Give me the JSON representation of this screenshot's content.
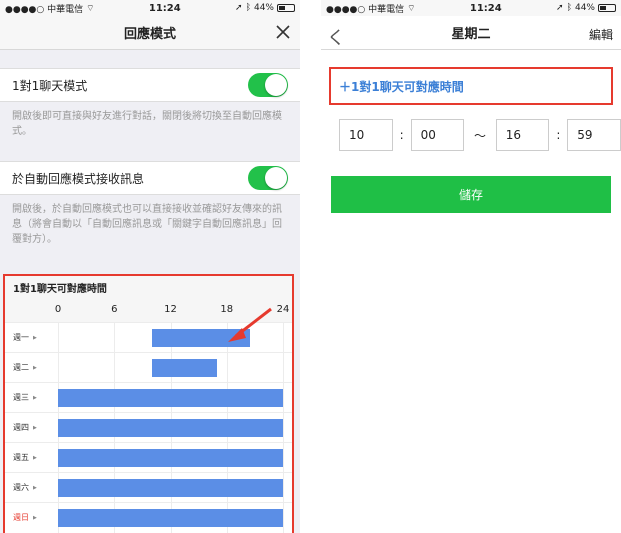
{
  "colors": {
    "toggle_on": "#22c14a",
    "highlight": "#e63a2e",
    "bar": "#5b8ee6",
    "link": "#3b7fd6",
    "save": "#1fbf46"
  },
  "status": {
    "carrier": "●●●●○ 中華電信",
    "time": "11:24",
    "battery": "44%"
  },
  "left": {
    "title": "回應模式",
    "close_icon": "close-icon",
    "chat_mode_label": "1對1聊天模式",
    "chat_mode_desc": "開啟後即可直接與好友進行對話，關閉後將切換至自動回應模式。",
    "auto_receive_label": "於自動回應模式接收訊息",
    "auto_receive_desc": "開啟後，於自動回應模式也可以直接接收並確認好友傳來的訊息（將會自動以「自動回應訊息或「關鍵字自動回應訊息」回覆對方）。",
    "schedule": {
      "title": "1對1聊天可對應時間",
      "hours": [
        "0",
        "6",
        "12",
        "18",
        "24"
      ],
      "days": [
        {
          "label": "週一",
          "start": 10,
          "end": 20.5,
          "sunday": false
        },
        {
          "label": "週二",
          "start": 10,
          "end": 17,
          "sunday": false
        },
        {
          "label": "週三",
          "start": 0,
          "end": 24,
          "sunday": false
        },
        {
          "label": "週四",
          "start": 0,
          "end": 24,
          "sunday": false
        },
        {
          "label": "週五",
          "start": 0,
          "end": 24,
          "sunday": false
        },
        {
          "label": "週六",
          "start": 0,
          "end": 24,
          "sunday": false
        },
        {
          "label": "週日",
          "start": 0,
          "end": 24,
          "sunday": true
        }
      ]
    }
  },
  "right": {
    "back": "く",
    "title": "星期二",
    "edit": "編輯",
    "add_label": "＋1對1聊天可對應時間",
    "start_hour": "10",
    "start_min": "00",
    "tilde": "～",
    "end_hour": "16",
    "end_min": "59",
    "save": "儲存"
  }
}
